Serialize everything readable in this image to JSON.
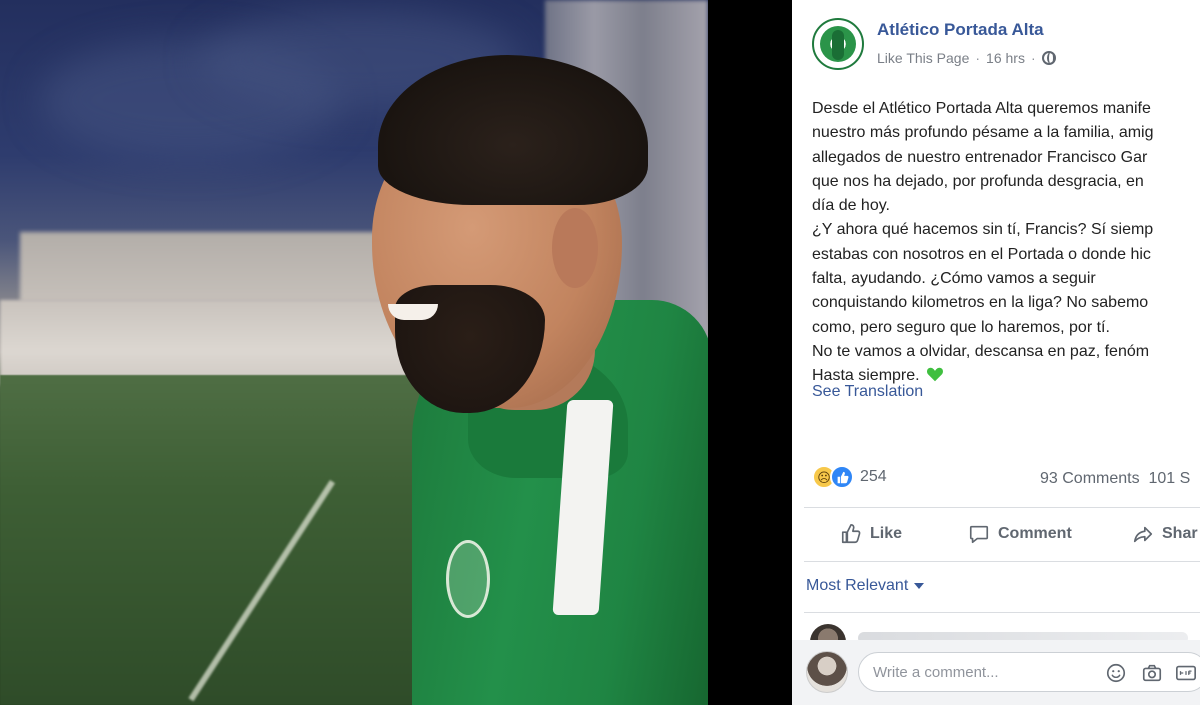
{
  "post": {
    "page_name": "Atlético Portada Alta",
    "like_page": "Like This Page",
    "time": "16 hrs",
    "body_lines": [
      "Desde el Atlético Portada Alta queremos manife",
      "nuestro más profundo pésame a la familia, amig",
      "allegados de nuestro entrenador Francisco Gar",
      "que nos ha dejado, por profunda desgracia, en",
      "día de hoy.",
      "¿Y ahora qué hacemos sin tí, Francis? Sí siemp",
      "estabas con nosotros en el Portada o donde hic",
      "falta, ayudando. ¿Cómo vamos a seguir",
      "conquistando kilometros en la liga? No sabemo",
      "como, pero seguro que lo haremos, por tí.",
      "No te vamos a olvidar, descansa en paz, fenóm",
      "Hasta siempre."
    ],
    "see_translation": "See Translation",
    "reaction_count": "254",
    "comments_count": "93 Comments",
    "shares_count": "101 S"
  },
  "actions": {
    "like": "Like",
    "comment": "Comment",
    "share": "Shar"
  },
  "comments": {
    "sort_label": "Most Relevant",
    "write_placeholder": "Write a comment..."
  },
  "icons": [
    "globe-icon",
    "green-heart-icon",
    "sad-reaction-icon",
    "like-reaction-icon",
    "thumbs-up-icon",
    "speech-bubble-icon",
    "share-arrow-icon",
    "emoji-icon",
    "camera-icon",
    "gif-icon"
  ],
  "colors": {
    "link_blue": "#385898",
    "text": "#222222",
    "muted": "#606770",
    "jersey_green": "#1f8543"
  }
}
